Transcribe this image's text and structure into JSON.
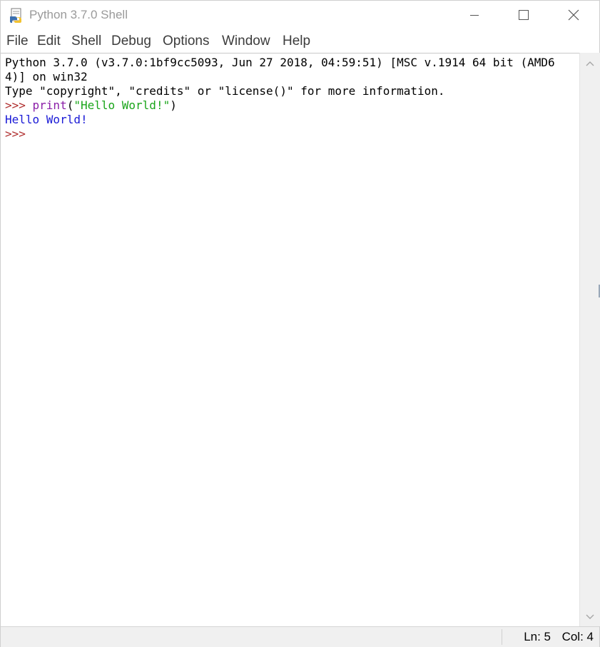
{
  "window": {
    "title": "Python 3.7.0 Shell",
    "app_icon": "python-idle-icon",
    "controls": {
      "minimize_icon": "minimize-icon",
      "maximize_icon": "maximize-icon",
      "close_icon": "close-icon"
    }
  },
  "menu": {
    "items": [
      {
        "label": "File"
      },
      {
        "label": "Edit"
      },
      {
        "label": "Shell"
      },
      {
        "label": "Debug"
      },
      {
        "label": "Options"
      },
      {
        "label": "Window"
      },
      {
        "label": "Help"
      }
    ]
  },
  "shell": {
    "banner_line1": "Python 3.7.0 (v3.7.0:1bf9cc5093, Jun 27 2018, 04:59:51) [MSC v.1914 64 bit (AMD6",
    "banner_line2": "4)] on win32",
    "banner_line3": "Type \"copyright\", \"credits\" or \"license()\" for more information.",
    "prompt": ">>> ",
    "input_builtin": "print",
    "input_paren_open": "(",
    "input_string": "\"Hello World!\"",
    "input_paren_close": ")",
    "output": "Hello World!",
    "final_prompt": ">>>"
  },
  "colors": {
    "prompt": "#b02f2f",
    "builtin": "#8b1fa8",
    "string": "#1aa51a",
    "output": "#1a1ad6"
  },
  "scrollbar": {
    "up_icon": "scroll-up-arrow-icon",
    "down_icon": "scroll-down-arrow-icon"
  },
  "status": {
    "ln": "Ln: 5",
    "col": "Col: 4"
  }
}
